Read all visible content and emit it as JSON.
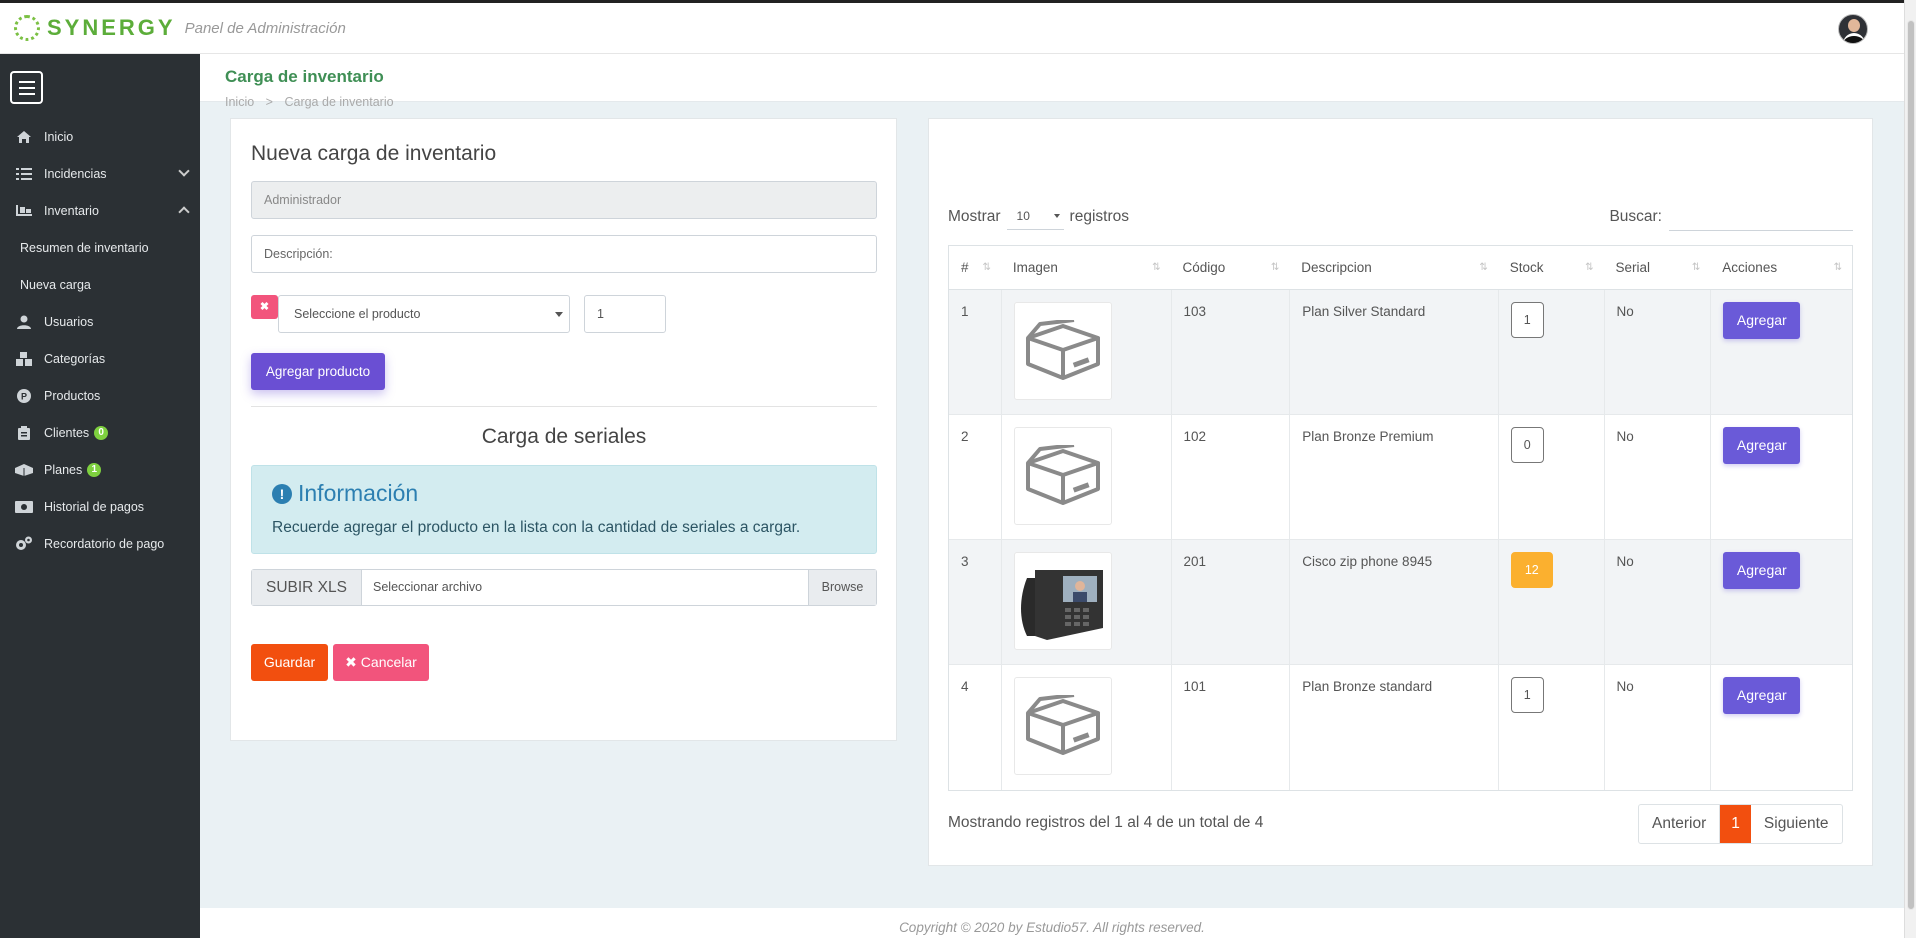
{
  "brand": {
    "name": "SYNERGY",
    "subtitle": "Panel de Administración"
  },
  "sidebar": {
    "items": [
      {
        "label": "Inicio",
        "icon": "home-icon"
      },
      {
        "label": "Incidencias",
        "icon": "list-icon",
        "expandable": true
      },
      {
        "label": "Inventario",
        "icon": "dolly-icon",
        "expanded": true
      },
      {
        "label": "Resumen de inventario",
        "sub": true
      },
      {
        "label": "Nueva carga",
        "sub": true
      },
      {
        "label": "Usuarios",
        "icon": "user-icon"
      },
      {
        "label": "Categorías",
        "icon": "boxes-icon"
      },
      {
        "label": "Productos",
        "icon": "product-icon"
      },
      {
        "label": "Clientes",
        "icon": "clipboard-icon",
        "badge": "0"
      },
      {
        "label": "Planes",
        "icon": "package-icon",
        "badge": "1"
      },
      {
        "label": "Historial de pagos",
        "icon": "money-icon"
      },
      {
        "label": "Recordatorio de pago",
        "icon": "cogs-icon"
      }
    ]
  },
  "page": {
    "title": "Carga de inventario",
    "breadcrumb": [
      "Inicio",
      "Carga de inventario"
    ]
  },
  "form": {
    "title": "Nueva carga de inventario",
    "user_value": "Administrador",
    "description_placeholder": "Descripción:",
    "remove_label": "✖",
    "product_select": "Seleccione el producto",
    "quantity": "1",
    "add_product_label": "Agregar producto",
    "serials_title": "Carga de seriales",
    "info_title": "Información",
    "info_text": "Recuerde agregar el producto en la lista con la cantidad de seriales a cargar.",
    "upload_label": "SUBIR XLS",
    "file_placeholder": "Seleccionar archivo",
    "browse_label": "Browse",
    "save_label": "Guardar",
    "cancel_label": "Cancelar"
  },
  "table": {
    "show_label": "Mostrar",
    "page_size": "10",
    "records_label": "registros",
    "search_label": "Buscar:",
    "columns": [
      "#",
      "Imagen",
      "Código",
      "Descripcion",
      "Stock",
      "Serial",
      "Acciones"
    ],
    "rows": [
      {
        "num": "1",
        "image": "box-icon",
        "code": "103",
        "desc": "Plan Silver Standard",
        "stock": "1",
        "serial": "No",
        "action": "Agregar"
      },
      {
        "num": "2",
        "image": "box-icon",
        "code": "102",
        "desc": "Plan Bronze Premium",
        "stock": "0",
        "serial": "No",
        "action": "Agregar"
      },
      {
        "num": "3",
        "image": "phone-icon",
        "code": "201",
        "desc": "Cisco zip phone 8945",
        "stock": "12",
        "serial": "No",
        "action": "Agregar",
        "stock_highlight": true
      },
      {
        "num": "4",
        "image": "box-icon",
        "code": "101",
        "desc": "Plan Bronze standard",
        "stock": "1",
        "serial": "No",
        "action": "Agregar"
      }
    ],
    "info": "Mostrando registros del 1 al 4 de un total de 4",
    "pagination": {
      "prev": "Anterior",
      "current": "1",
      "next": "Siguiente"
    }
  },
  "footer": "Copyright © 2020 by Estudio57. All rights reserved.",
  "colors": {
    "brand_green": "#5cad3a",
    "accent_purple": "#6a4fd3",
    "orange": "#f24f0f",
    "pink": "#f2547c",
    "sidebar_bg": "#2b3034"
  }
}
